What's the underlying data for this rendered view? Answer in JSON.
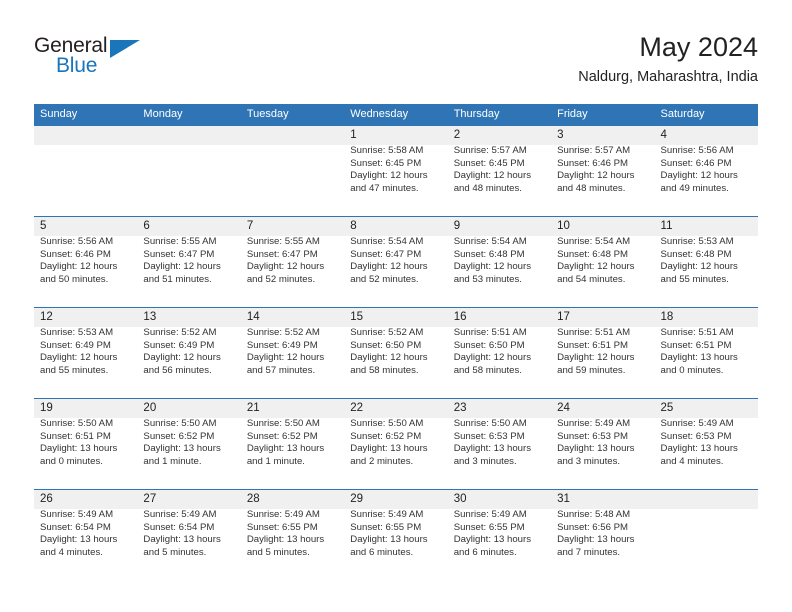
{
  "brand": {
    "name_part1": "General",
    "name_part2": "Blue"
  },
  "header": {
    "title": "May 2024",
    "subtitle": "Naldurg, Maharashtra, India"
  },
  "colors": {
    "header_blue": "#2f75b5",
    "brand_blue": "#1b75bb",
    "daynum_band": "#f0f0f0"
  },
  "calendar": {
    "weekdays": [
      "Sunday",
      "Monday",
      "Tuesday",
      "Wednesday",
      "Thursday",
      "Friday",
      "Saturday"
    ],
    "weeks": [
      [
        {
          "day": "",
          "sunrise": "",
          "sunset": "",
          "daylight1": "",
          "daylight2": ""
        },
        {
          "day": "",
          "sunrise": "",
          "sunset": "",
          "daylight1": "",
          "daylight2": ""
        },
        {
          "day": "",
          "sunrise": "",
          "sunset": "",
          "daylight1": "",
          "daylight2": ""
        },
        {
          "day": "1",
          "sunrise": "Sunrise: 5:58 AM",
          "sunset": "Sunset: 6:45 PM",
          "daylight1": "Daylight: 12 hours",
          "daylight2": "and 47 minutes."
        },
        {
          "day": "2",
          "sunrise": "Sunrise: 5:57 AM",
          "sunset": "Sunset: 6:45 PM",
          "daylight1": "Daylight: 12 hours",
          "daylight2": "and 48 minutes."
        },
        {
          "day": "3",
          "sunrise": "Sunrise: 5:57 AM",
          "sunset": "Sunset: 6:46 PM",
          "daylight1": "Daylight: 12 hours",
          "daylight2": "and 48 minutes."
        },
        {
          "day": "4",
          "sunrise": "Sunrise: 5:56 AM",
          "sunset": "Sunset: 6:46 PM",
          "daylight1": "Daylight: 12 hours",
          "daylight2": "and 49 minutes."
        }
      ],
      [
        {
          "day": "5",
          "sunrise": "Sunrise: 5:56 AM",
          "sunset": "Sunset: 6:46 PM",
          "daylight1": "Daylight: 12 hours",
          "daylight2": "and 50 minutes."
        },
        {
          "day": "6",
          "sunrise": "Sunrise: 5:55 AM",
          "sunset": "Sunset: 6:47 PM",
          "daylight1": "Daylight: 12 hours",
          "daylight2": "and 51 minutes."
        },
        {
          "day": "7",
          "sunrise": "Sunrise: 5:55 AM",
          "sunset": "Sunset: 6:47 PM",
          "daylight1": "Daylight: 12 hours",
          "daylight2": "and 52 minutes."
        },
        {
          "day": "8",
          "sunrise": "Sunrise: 5:54 AM",
          "sunset": "Sunset: 6:47 PM",
          "daylight1": "Daylight: 12 hours",
          "daylight2": "and 52 minutes."
        },
        {
          "day": "9",
          "sunrise": "Sunrise: 5:54 AM",
          "sunset": "Sunset: 6:48 PM",
          "daylight1": "Daylight: 12 hours",
          "daylight2": "and 53 minutes."
        },
        {
          "day": "10",
          "sunrise": "Sunrise: 5:54 AM",
          "sunset": "Sunset: 6:48 PM",
          "daylight1": "Daylight: 12 hours",
          "daylight2": "and 54 minutes."
        },
        {
          "day": "11",
          "sunrise": "Sunrise: 5:53 AM",
          "sunset": "Sunset: 6:48 PM",
          "daylight1": "Daylight: 12 hours",
          "daylight2": "and 55 minutes."
        }
      ],
      [
        {
          "day": "12",
          "sunrise": "Sunrise: 5:53 AM",
          "sunset": "Sunset: 6:49 PM",
          "daylight1": "Daylight: 12 hours",
          "daylight2": "and 55 minutes."
        },
        {
          "day": "13",
          "sunrise": "Sunrise: 5:52 AM",
          "sunset": "Sunset: 6:49 PM",
          "daylight1": "Daylight: 12 hours",
          "daylight2": "and 56 minutes."
        },
        {
          "day": "14",
          "sunrise": "Sunrise: 5:52 AM",
          "sunset": "Sunset: 6:49 PM",
          "daylight1": "Daylight: 12 hours",
          "daylight2": "and 57 minutes."
        },
        {
          "day": "15",
          "sunrise": "Sunrise: 5:52 AM",
          "sunset": "Sunset: 6:50 PM",
          "daylight1": "Daylight: 12 hours",
          "daylight2": "and 58 minutes."
        },
        {
          "day": "16",
          "sunrise": "Sunrise: 5:51 AM",
          "sunset": "Sunset: 6:50 PM",
          "daylight1": "Daylight: 12 hours",
          "daylight2": "and 58 minutes."
        },
        {
          "day": "17",
          "sunrise": "Sunrise: 5:51 AM",
          "sunset": "Sunset: 6:51 PM",
          "daylight1": "Daylight: 12 hours",
          "daylight2": "and 59 minutes."
        },
        {
          "day": "18",
          "sunrise": "Sunrise: 5:51 AM",
          "sunset": "Sunset: 6:51 PM",
          "daylight1": "Daylight: 13 hours",
          "daylight2": "and 0 minutes."
        }
      ],
      [
        {
          "day": "19",
          "sunrise": "Sunrise: 5:50 AM",
          "sunset": "Sunset: 6:51 PM",
          "daylight1": "Daylight: 13 hours",
          "daylight2": "and 0 minutes."
        },
        {
          "day": "20",
          "sunrise": "Sunrise: 5:50 AM",
          "sunset": "Sunset: 6:52 PM",
          "daylight1": "Daylight: 13 hours",
          "daylight2": "and 1 minute."
        },
        {
          "day": "21",
          "sunrise": "Sunrise: 5:50 AM",
          "sunset": "Sunset: 6:52 PM",
          "daylight1": "Daylight: 13 hours",
          "daylight2": "and 1 minute."
        },
        {
          "day": "22",
          "sunrise": "Sunrise: 5:50 AM",
          "sunset": "Sunset: 6:52 PM",
          "daylight1": "Daylight: 13 hours",
          "daylight2": "and 2 minutes."
        },
        {
          "day": "23",
          "sunrise": "Sunrise: 5:50 AM",
          "sunset": "Sunset: 6:53 PM",
          "daylight1": "Daylight: 13 hours",
          "daylight2": "and 3 minutes."
        },
        {
          "day": "24",
          "sunrise": "Sunrise: 5:49 AM",
          "sunset": "Sunset: 6:53 PM",
          "daylight1": "Daylight: 13 hours",
          "daylight2": "and 3 minutes."
        },
        {
          "day": "25",
          "sunrise": "Sunrise: 5:49 AM",
          "sunset": "Sunset: 6:53 PM",
          "daylight1": "Daylight: 13 hours",
          "daylight2": "and 4 minutes."
        }
      ],
      [
        {
          "day": "26",
          "sunrise": "Sunrise: 5:49 AM",
          "sunset": "Sunset: 6:54 PM",
          "daylight1": "Daylight: 13 hours",
          "daylight2": "and 4 minutes."
        },
        {
          "day": "27",
          "sunrise": "Sunrise: 5:49 AM",
          "sunset": "Sunset: 6:54 PM",
          "daylight1": "Daylight: 13 hours",
          "daylight2": "and 5 minutes."
        },
        {
          "day": "28",
          "sunrise": "Sunrise: 5:49 AM",
          "sunset": "Sunset: 6:55 PM",
          "daylight1": "Daylight: 13 hours",
          "daylight2": "and 5 minutes."
        },
        {
          "day": "29",
          "sunrise": "Sunrise: 5:49 AM",
          "sunset": "Sunset: 6:55 PM",
          "daylight1": "Daylight: 13 hours",
          "daylight2": "and 6 minutes."
        },
        {
          "day": "30",
          "sunrise": "Sunrise: 5:49 AM",
          "sunset": "Sunset: 6:55 PM",
          "daylight1": "Daylight: 13 hours",
          "daylight2": "and 6 minutes."
        },
        {
          "day": "31",
          "sunrise": "Sunrise: 5:48 AM",
          "sunset": "Sunset: 6:56 PM",
          "daylight1": "Daylight: 13 hours",
          "daylight2": "and 7 minutes."
        },
        {
          "day": "",
          "sunrise": "",
          "sunset": "",
          "daylight1": "",
          "daylight2": ""
        }
      ]
    ]
  }
}
